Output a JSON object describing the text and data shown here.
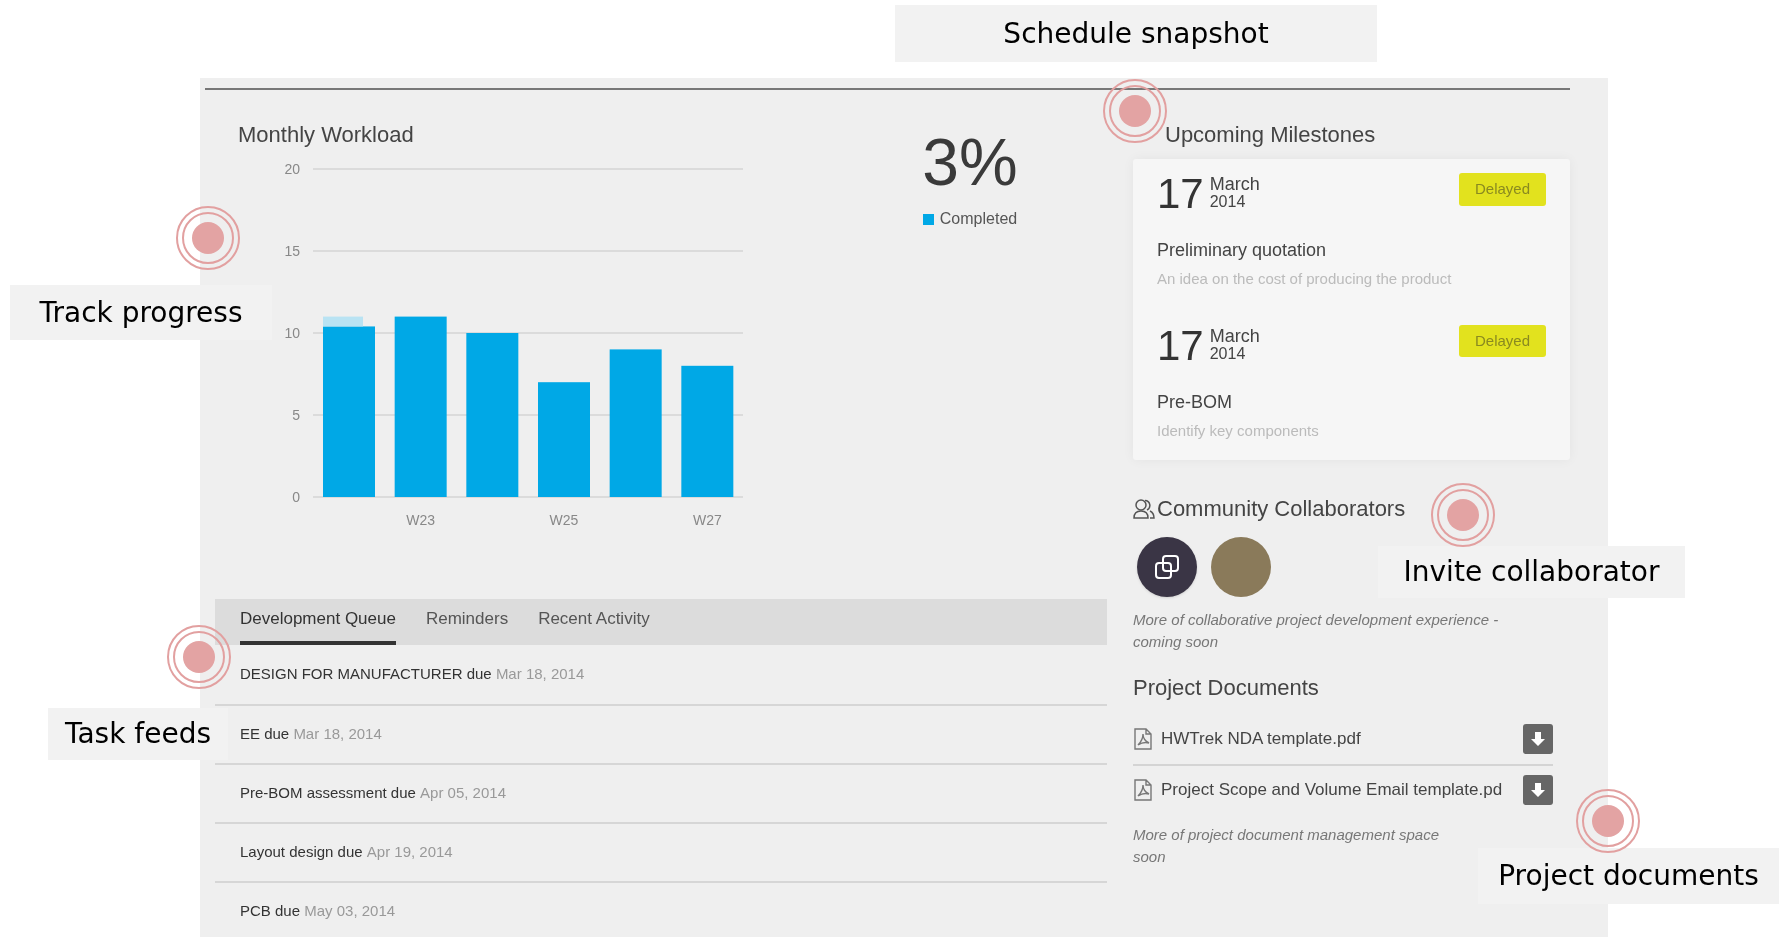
{
  "annotations": [
    {
      "label": "Schedule snapshot"
    },
    {
      "label": "Track progress"
    },
    {
      "label": "Task feeds"
    },
    {
      "label": "Invite collaborator"
    },
    {
      "label": "Project documents"
    }
  ],
  "workload": {
    "title": "Monthly Workload",
    "summary": {
      "value": "3%"
    },
    "chart_data": {
      "type": "bar",
      "stacked": true,
      "categories": [
        null,
        "W23",
        null,
        "W25",
        null,
        "W27"
      ],
      "yticks": [
        0,
        5,
        10,
        15,
        20
      ],
      "ylim": [
        0,
        20
      ],
      "grid": true,
      "series": [
        {
          "name": "Completed",
          "color": "#00a8e6",
          "values": [
            10.4,
            11,
            10,
            7,
            9,
            8
          ]
        },
        {
          "color": "#b9e3f3",
          "values": [
            0.6,
            null,
            null,
            null,
            null,
            null
          ]
        }
      ]
    }
  },
  "tabs": [
    {
      "label": "Development Queue",
      "selected": true
    },
    {
      "label": "Reminders",
      "selected": false
    },
    {
      "label": "Recent Activity",
      "selected": false
    }
  ],
  "tasks": [
    {
      "name": "DESIGN FOR MANUFACTURER due",
      "date": "Mar 18, 2014"
    },
    {
      "name": "EE due",
      "date": "Mar 18, 2014"
    },
    {
      "name": "Pre-BOM assessment due",
      "date": "Apr 05, 2014"
    },
    {
      "name": "Layout design due",
      "date": "Apr 19, 2014"
    },
    {
      "name": "PCB due",
      "date": "May 03, 2014"
    }
  ],
  "milestones": {
    "title": "Upcoming Milestones",
    "items": [
      {
        "day": "17",
        "month": "March",
        "year": "2014",
        "status": "Delayed",
        "title": "Preliminary quotation",
        "description": "An idea on the cost of producing the product"
      },
      {
        "day": "17",
        "month": "March",
        "year": "2014",
        "status": "Delayed",
        "title": "Pre-BOM",
        "description": "Identify key components"
      }
    ]
  },
  "collaborators": {
    "title": "Community Collaborators",
    "note": "More of collaborative project development experience - coming soon"
  },
  "documents": {
    "title": "Project Documents",
    "files": [
      {
        "name": "HWTrek NDA template.pdf"
      },
      {
        "name": "Project Scope and Volume Email template.pd"
      }
    ],
    "note": [
      "More of project document management space",
      "soon"
    ]
  }
}
